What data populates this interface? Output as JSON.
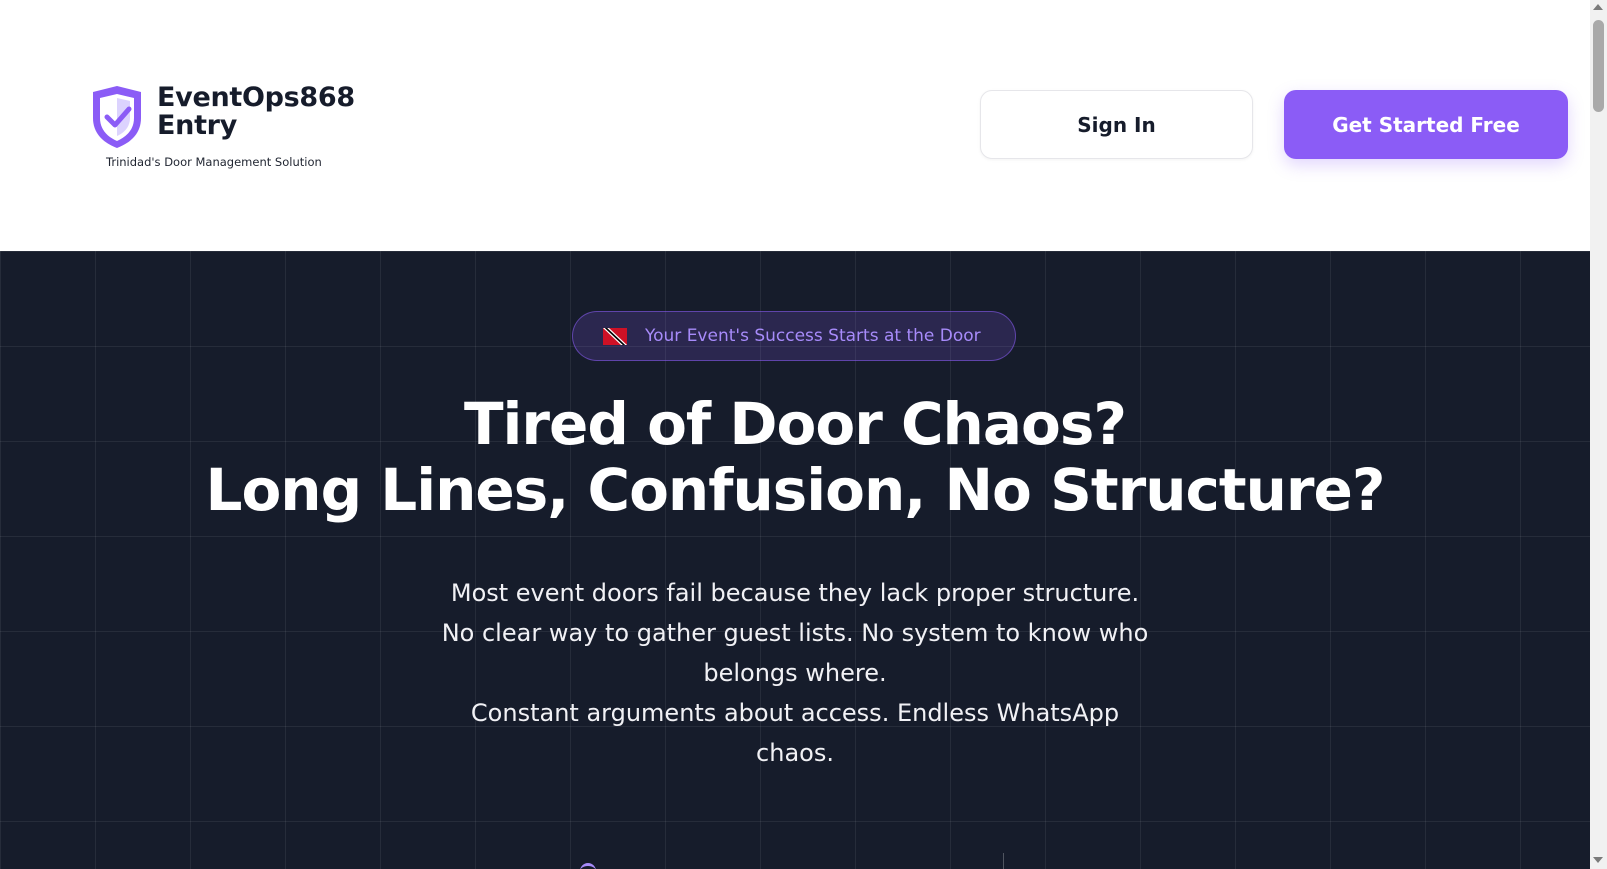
{
  "header": {
    "brand_name_line1": "EventOps868",
    "brand_name_line2": "Entry",
    "brand_tagline": "Trinidad's Door Management Solution",
    "logo_icon": "shield-check-icon",
    "signin_label": "Sign In",
    "cta_label": "Get Started Free"
  },
  "hero": {
    "badge_icon": "trinidad-flag-icon",
    "badge_text": "Your Event's Success Starts at the Door",
    "headline_line1": "Tired of Door Chaos?",
    "headline_line2": "Long Lines, Confusion, No Structure?",
    "subcopy_line1": "Most event doors fail because they lack proper structure.",
    "subcopy_line2": "No clear way to gather guest lists. No system to know who",
    "subcopy_line3": "belongs where.",
    "subcopy_line4": "Constant arguments about access. Endless WhatsApp",
    "subcopy_line5": "chaos."
  },
  "colors": {
    "accent": "#8b5cf6",
    "accent_light": "#a78bfa",
    "hero_bg": "#161c2b",
    "text_dark": "#161c2b"
  }
}
